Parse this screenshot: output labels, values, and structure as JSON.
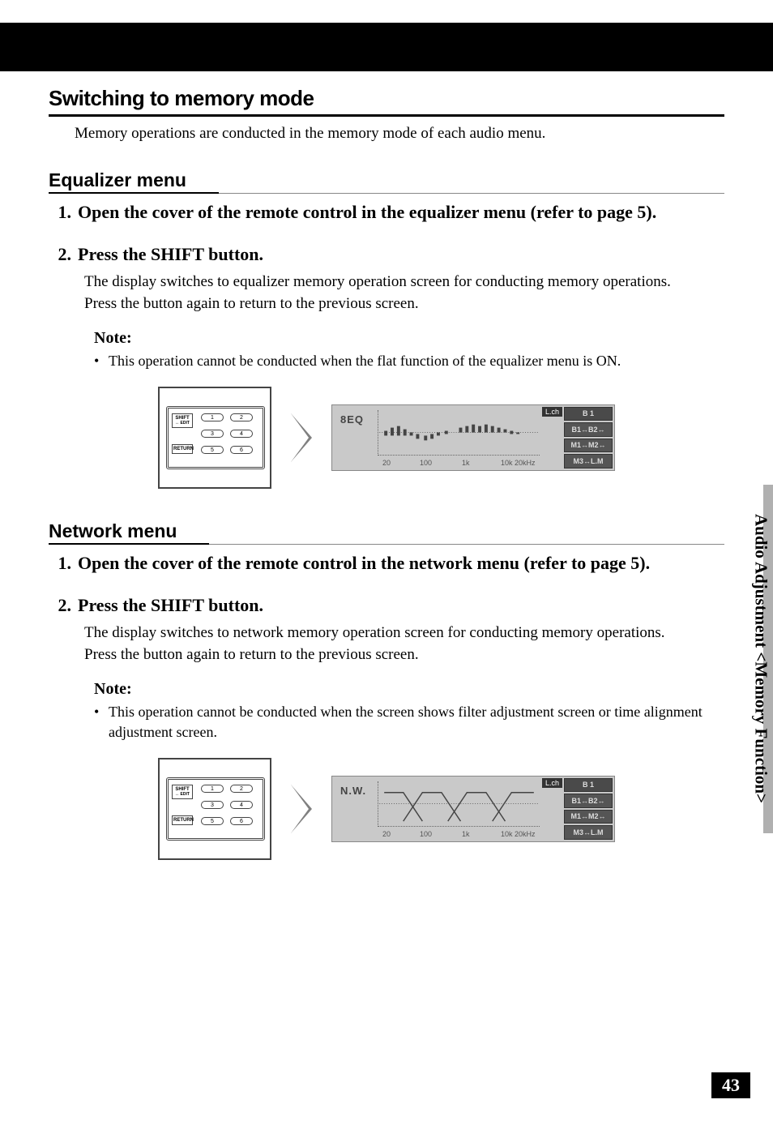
{
  "header": {
    "main_title": "Switching to memory mode",
    "intro": "Memory operations are conducted in the memory mode of each audio menu."
  },
  "equalizer": {
    "title": "Equalizer menu",
    "steps": [
      {
        "num": "1.",
        "title": "Open the cover of the remote control in the equalizer menu (refer to page 5).",
        "text": ""
      },
      {
        "num": "2.",
        "title": "Press the SHIFT button.",
        "text": "The display switches to equalizer memory operation screen for conducting memory operations. Press the button again to return to the previous screen."
      }
    ],
    "note_label": "Note:",
    "note_text": "This operation cannot be conducted when the flat function of the equalizer menu is ON.",
    "figure": {
      "remote": {
        "shift": "SHIFT",
        "edit": "↔ EDIT",
        "return": "RETURN",
        "nums": [
          "1",
          "2",
          "3",
          "4",
          "5",
          "6"
        ]
      },
      "screen": {
        "label": "8EQ",
        "lch": "L.ch",
        "axis": [
          "20",
          "100",
          "1k",
          "10k 20kHz"
        ],
        "panel": [
          "B 1",
          "B1↔B2↔",
          "M1↔M2↔",
          "M3↔L.M"
        ]
      }
    }
  },
  "network": {
    "title": "Network menu",
    "steps": [
      {
        "num": "1.",
        "title": "Open the cover of the remote control in the network menu (refer to page 5).",
        "text": ""
      },
      {
        "num": "2.",
        "title": "Press the SHIFT button.",
        "text": "The display switches to network memory operation screen for conducting memory operations. Press the button again to return to the previous screen."
      }
    ],
    "note_label": "Note:",
    "note_text": "This operation cannot be conducted when the screen shows filter adjustment screen or time alignment adjustment screen.",
    "figure": {
      "remote": {
        "shift": "SHIFT",
        "edit": "↔ EDIT",
        "return": "RETURN",
        "nums": [
          "1",
          "2",
          "3",
          "4",
          "5",
          "6"
        ]
      },
      "screen": {
        "label": "N.W.",
        "lch": "L.ch",
        "axis": [
          "20",
          "100",
          "1k",
          "10k 20kHz"
        ],
        "panel": [
          "B 1",
          "B1↔B2↔",
          "M1↔M2↔",
          "M3↔L.M"
        ]
      }
    }
  },
  "side_tab": "Audio Adjustment <Memory Function>",
  "page_number": "43"
}
